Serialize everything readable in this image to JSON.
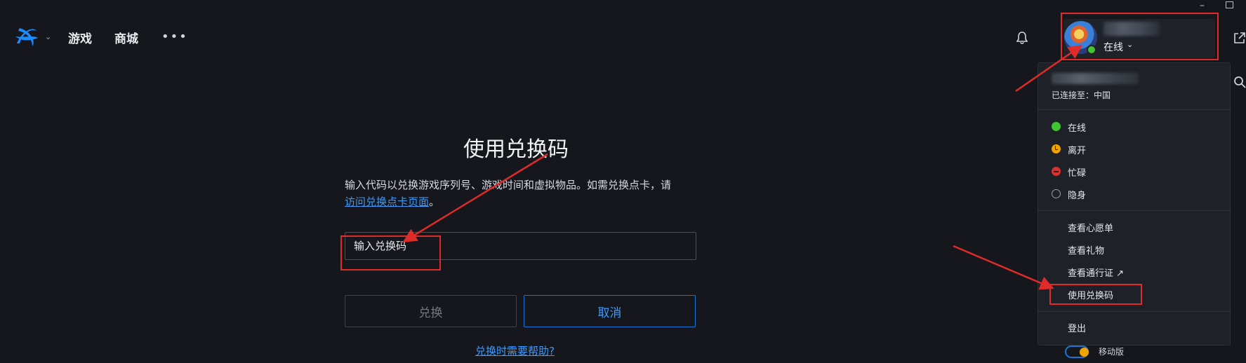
{
  "header": {
    "nav": {
      "games": "游戏",
      "shop": "商城",
      "more": "•••"
    },
    "window": {
      "minimize": "–"
    }
  },
  "profile": {
    "status": "在线",
    "connected_to": "已连接至：中国"
  },
  "status_menu": [
    {
      "label": "在线",
      "icon": "online-status-icon",
      "color": "#41c431"
    },
    {
      "label": "离开",
      "icon": "away-status-icon",
      "color": "#f0a200"
    },
    {
      "label": "忙碌",
      "icon": "busy-status-icon",
      "color": "#d93030"
    },
    {
      "label": "隐身",
      "icon": "invisible-status-icon",
      "color": "#9aa0a8"
    }
  ],
  "actions_menu": {
    "wishlist": "查看心愿单",
    "gifts": "查看礼物",
    "battle_pass": "查看通行证 ↗",
    "use_code": "使用兑换码",
    "logout": "登出",
    "mobile": "移动版"
  },
  "redeem": {
    "title": "使用兑换码",
    "description": "输入代码以兑换游戏序列号、游戏时间和虚拟物品。如需兑换点卡，请",
    "link": "访问兑换点卡页面",
    "period": "。",
    "placeholder": "输入兑换码",
    "redeem_button": "兑换",
    "cancel_button": "取消",
    "help_link": "兑换时需要帮助?"
  },
  "colors": {
    "background": "#15171d",
    "accent_blue": "#3a9bff",
    "annotation_red": "#e02b2b"
  }
}
